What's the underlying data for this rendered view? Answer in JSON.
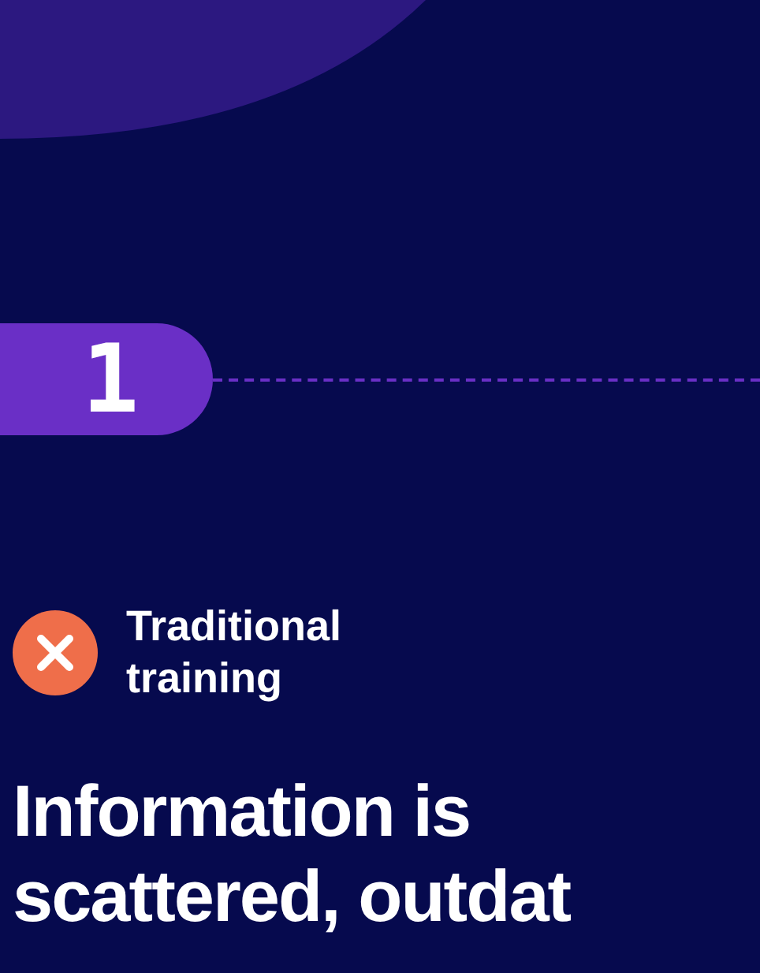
{
  "step": {
    "number": "1"
  },
  "label": {
    "text": "Traditional training",
    "kind": "negative"
  },
  "heading": {
    "lines": [
      "Information is",
      "scattered, outdat"
    ]
  }
}
